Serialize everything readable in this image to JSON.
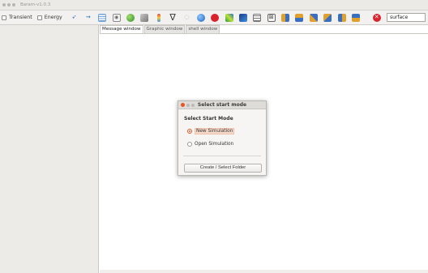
{
  "window": {
    "title": "Baram-v1.0.3"
  },
  "toolbar": {
    "transient_label": "Transient",
    "energy_label": "Energy",
    "search_value": "surface",
    "icons": [
      "vector-icon",
      "streamline-icon",
      "mesh-grid-icon",
      "camera-icon",
      "sphere-icon",
      "cube-icon",
      "colorbar-icon",
      "funnel-icon",
      "clip-icon",
      "globe-icon",
      "stop-icon",
      "contour-icon",
      "surface-icon",
      "table-icon",
      "probe-icon",
      "slice-x-icon",
      "slice-y-icon",
      "slice-z-icon",
      "slice-xy-icon",
      "slice-xz-icon",
      "slice-yz-icon",
      "close-circle-icon"
    ]
  },
  "tabs": [
    "Message window",
    "Graphic window",
    "shell window"
  ],
  "dialog": {
    "title": "Select start mode",
    "heading": "Select Start Mode",
    "options": [
      "New Simulation",
      "Open Simulation"
    ],
    "selected": "New Simulation",
    "button_label": "Create / Select Folder"
  },
  "colors": {
    "accent": "#e95420",
    "background": "#ffffff",
    "panel": "#ecebe8"
  }
}
